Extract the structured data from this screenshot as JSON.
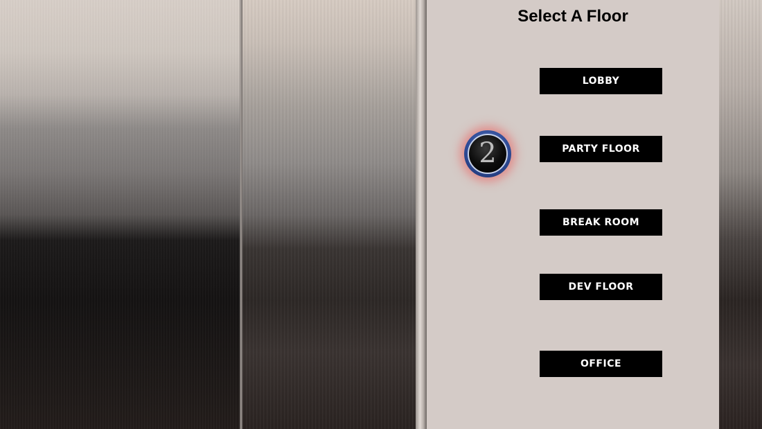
{
  "panel": {
    "title": "Select A Floor"
  },
  "indicator": {
    "current_floor": "2",
    "glow_color": "#eb5a5a",
    "ring_color": "#2f4c98"
  },
  "floors": [
    {
      "label": "LOBBY"
    },
    {
      "label": "PARTY FLOOR"
    },
    {
      "label": "BREAK ROOM"
    },
    {
      "label": "DEV FLOOR"
    },
    {
      "label": "OFFICE"
    }
  ],
  "colors": {
    "panel_bg": "#d4cbc7",
    "button_bg": "#000000",
    "button_text": "#ffffff"
  }
}
